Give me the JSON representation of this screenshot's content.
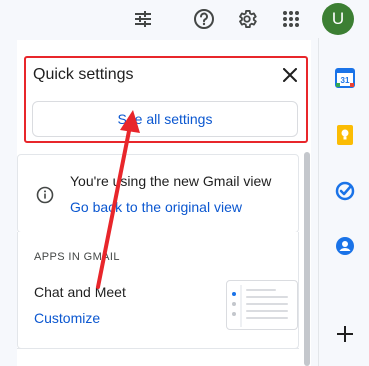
{
  "header": {
    "icons": [
      "filter-icon",
      "help-icon",
      "settings-gear-icon",
      "apps-grid-icon"
    ],
    "avatar_letter": "U",
    "avatar_color": "#3c7f33"
  },
  "quick_settings": {
    "title": "Quick settings",
    "see_all_label": "See all settings",
    "info_text": "You're using the new Gmail view",
    "go_back_link": "Go back to the original view",
    "apps_section_label": "APPS IN GMAIL",
    "chat_meet_label": "Chat and Meet",
    "customize_link": "Customize"
  },
  "side_apps": [
    "calendar-icon",
    "keep-icon",
    "tasks-icon",
    "contacts-icon",
    "add-icon"
  ],
  "calendar_day": "31",
  "colors": {
    "highlight": "#e8262b",
    "link": "#0b57d0",
    "background": "#f6f8fc"
  }
}
